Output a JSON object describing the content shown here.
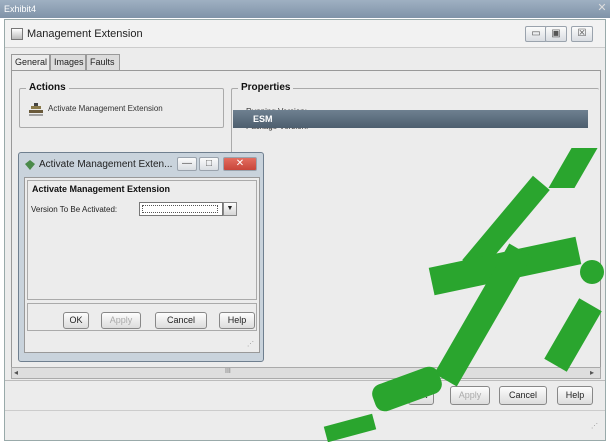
{
  "exhibit": {
    "title": "Exhibit4",
    "close_glyph": "✕"
  },
  "main_window": {
    "title": "Management Extension",
    "minimize_glyph": "▭",
    "maximize_glyph": "▣",
    "close_glyph": "☒"
  },
  "tabs": [
    {
      "label": "General",
      "active": true
    },
    {
      "label": "Images",
      "active": false
    },
    {
      "label": "Faults",
      "active": false
    }
  ],
  "actions": {
    "title": "Actions",
    "item_label": "Activate Management Extension",
    "item_icon": "stack-icon"
  },
  "properties": {
    "title": "Properties",
    "running_version_label": "Running Version:",
    "package_version_label": "Package Version:",
    "esm_label": "ESM"
  },
  "scrollbar": {
    "thumb_glyph": "III"
  },
  "bottom_buttons": {
    "ok": "OK",
    "apply": "Apply",
    "cancel": "Cancel",
    "help": "Help"
  },
  "dialog": {
    "title": "Activate Management Exten...",
    "minimize_glyph": "—",
    "maximize_glyph": "□",
    "close_glyph": "✕",
    "group_title": "Activate Management Extension",
    "version_label": "Version To Be Activated:",
    "version_value": "",
    "dropdown_glyph": "▼",
    "buttons": {
      "ok": "OK",
      "apply": "Apply",
      "cancel": "Cancel",
      "help": "Help"
    }
  },
  "colors": {
    "accent": "#5a6b7b",
    "watermark": "#2aa52e",
    "dialog_close": "#c8453a"
  }
}
